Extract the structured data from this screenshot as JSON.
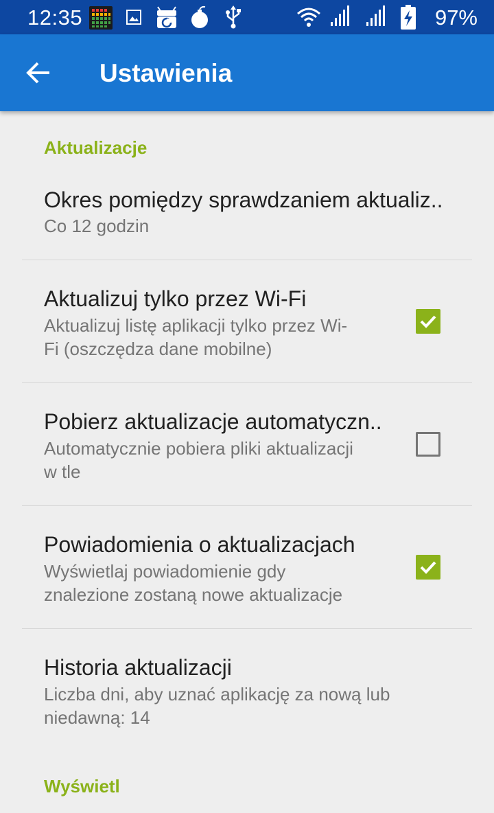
{
  "status_bar": {
    "time": "12:35",
    "battery_percent": "97%",
    "icons": [
      "equalizer-app-icon",
      "image-icon",
      "fdroid-icon",
      "bomb-icon",
      "usb-icon",
      "wifi-icon",
      "signal-icon",
      "signal-icon",
      "battery-charging-icon"
    ]
  },
  "app_bar": {
    "title": "Ustawienia",
    "back_icon": "arrow-back-icon"
  },
  "colors": {
    "status_bar": "#0d47a1",
    "app_bar": "#1976d2",
    "accent": "#8bb21a",
    "background": "#eeeeee"
  },
  "settings": {
    "category_updates": "Aktualizacje",
    "category_display": "Wyświetl",
    "update_interval": {
      "title": "Okres pomiędzy sprawdzaniem aktualiz..",
      "summary": "Co 12 godzin"
    },
    "wifi_only": {
      "title": "Aktualizuj tylko przez Wi-Fi",
      "summary_line1": "Aktualizuj listę aplikacji tylko przez Wi-",
      "summary_line2": "Fi (oszczędza dane mobilne)",
      "checked": true
    },
    "auto_download": {
      "title": "Pobierz aktualizacje automatyczn..",
      "summary_line1": "Automatycznie pobiera pliki aktualizacji",
      "summary_line2": "w tle",
      "checked": false
    },
    "notifications": {
      "title": "Powiadomienia o aktualizacjach",
      "summary_line1": "Wyświetlaj powiadomienie gdy",
      "summary_line2": "znalezione zostaną nowe aktualizacje",
      "checked": true
    },
    "history": {
      "title": "Historia aktualizacji",
      "summary_line1": "Liczba dni, aby uznać aplikację za nową lub",
      "summary_line2": "niedawną: 14"
    }
  }
}
